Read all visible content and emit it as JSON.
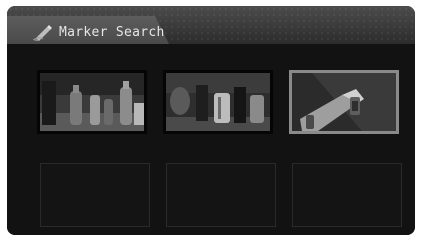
{
  "header": {
    "title": "Marker Search",
    "icon": "marker-pencil-icon"
  },
  "grid": {
    "selected_index": 2,
    "markers": [
      {
        "type": "thumbnail",
        "scene": "bottles-on-table"
      },
      {
        "type": "thumbnail",
        "scene": "glasses-and-mugs"
      },
      {
        "type": "thumbnail",
        "scene": "hand-holding-glass"
      },
      {
        "type": "empty"
      },
      {
        "type": "empty"
      },
      {
        "type": "empty"
      }
    ]
  },
  "colors": {
    "background": "#141414",
    "header": "#3a3a3a",
    "selection_border": "#8a8a8a",
    "text": "#e6e6e6"
  }
}
